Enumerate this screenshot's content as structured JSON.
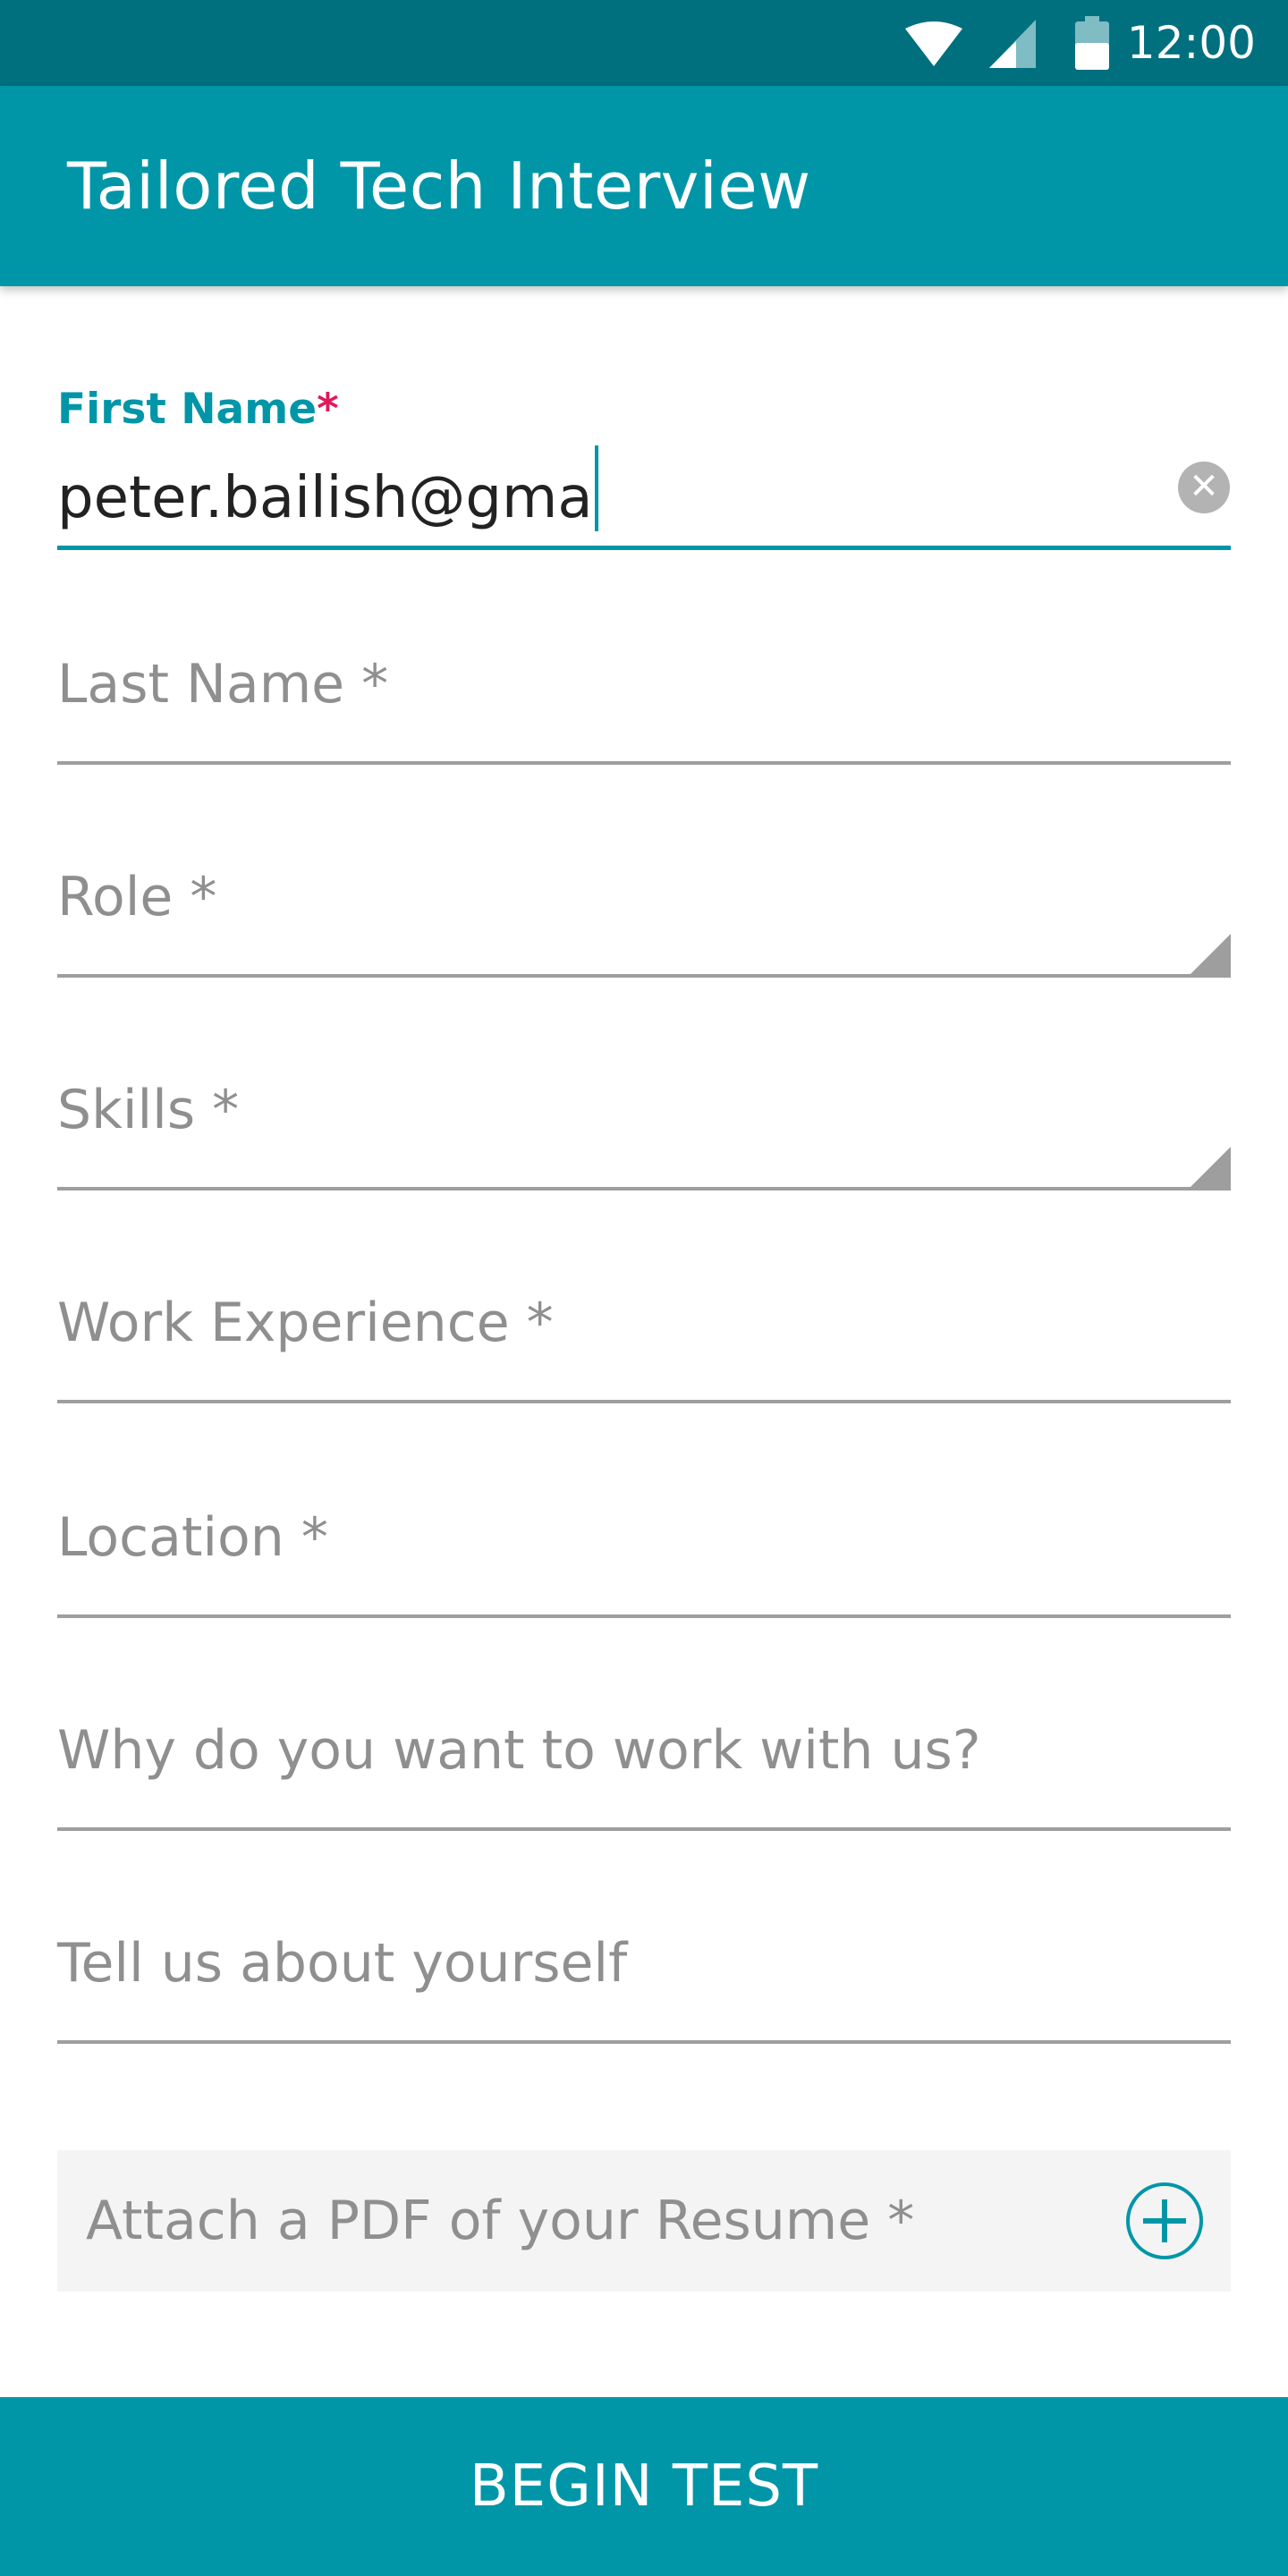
{
  "status_bar": {
    "time": "12:00",
    "icons": [
      "wifi-icon",
      "cell-signal-icon",
      "battery-icon"
    ]
  },
  "app_bar": {
    "title": "Tailored Tech Interview"
  },
  "form": {
    "first_name": {
      "label": "First Name",
      "required_mark": "*",
      "value": "peter.bailish@gma",
      "clear_icon": "close-icon"
    },
    "last_name": {
      "placeholder": "Last Name *"
    },
    "role": {
      "placeholder": "Role *"
    },
    "skills": {
      "placeholder": "Skills *"
    },
    "work_experience": {
      "placeholder": "Work Experience *"
    },
    "location": {
      "placeholder": "Location *"
    },
    "why_work": {
      "placeholder": "Why do you want to work with us?"
    },
    "about_yourself": {
      "placeholder": "Tell us about yourself"
    },
    "resume": {
      "label": "Attach a PDF of your Resume *",
      "icon": "plus-circle-icon"
    }
  },
  "actions": {
    "begin_label": "BEGIN TEST"
  },
  "colors": {
    "status_bar": "#00707f",
    "primary": "#0096a7",
    "required": "#e0185c",
    "placeholder": "#8f8f8f",
    "underline": "#9e9e9e"
  }
}
